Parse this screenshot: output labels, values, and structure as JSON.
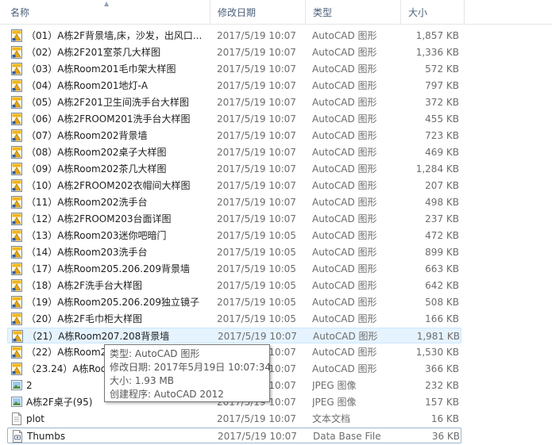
{
  "columns": {
    "name": "名称",
    "date": "修改日期",
    "type": "类型",
    "size": "大小"
  },
  "files": [
    {
      "name": "（01）A栋2F背景墙,床，沙发，出风口...",
      "date": "2017/5/19 10:07",
      "type": "AutoCAD 图形",
      "size": "1,857 KB",
      "icon": "autocad-icon"
    },
    {
      "name": "（02）A栋2F201室茶几大样图",
      "date": "2017/5/19 10:07",
      "type": "AutoCAD 图形",
      "size": "1,336 KB",
      "icon": "autocad-icon"
    },
    {
      "name": "（03）A栋Room201毛巾架大样图",
      "date": "2017/5/19 10:07",
      "type": "AutoCAD 图形",
      "size": "572 KB",
      "icon": "autocad-icon"
    },
    {
      "name": "（04）A栋Room201地灯-A",
      "date": "2017/5/19 10:07",
      "type": "AutoCAD 图形",
      "size": "797 KB",
      "icon": "autocad-icon"
    },
    {
      "name": "（05）A栋2F201卫生间洗手台大样图",
      "date": "2017/5/19 10:07",
      "type": "AutoCAD 图形",
      "size": "372 KB",
      "icon": "autocad-icon"
    },
    {
      "name": "（06）A栋2FROOM201洗手台大样图",
      "date": "2017/5/19 10:07",
      "type": "AutoCAD 图形",
      "size": "455 KB",
      "icon": "autocad-icon"
    },
    {
      "name": "（07）A栋Room202背景墙",
      "date": "2017/5/19 10:07",
      "type": "AutoCAD 图形",
      "size": "723 KB",
      "icon": "autocad-icon"
    },
    {
      "name": "（08）A栋Room202桌子大样图",
      "date": "2017/5/19 10:07",
      "type": "AutoCAD 图形",
      "size": "469 KB",
      "icon": "autocad-icon"
    },
    {
      "name": "（09）A栋Room202茶几大样图",
      "date": "2017/5/19 10:07",
      "type": "AutoCAD 图形",
      "size": "1,284 KB",
      "icon": "autocad-icon"
    },
    {
      "name": "（10）A栋2FROOM202衣帽间大样图",
      "date": "2017/5/19 10:07",
      "type": "AutoCAD 图形",
      "size": "207 KB",
      "icon": "autocad-icon"
    },
    {
      "name": "（11）A栋Room202洗手台",
      "date": "2017/5/19 10:07",
      "type": "AutoCAD 图形",
      "size": "498 KB",
      "icon": "autocad-icon"
    },
    {
      "name": "（12）A栋2FROOM203台面详图",
      "date": "2017/5/19 10:07",
      "type": "AutoCAD 图形",
      "size": "237 KB",
      "icon": "autocad-icon"
    },
    {
      "name": "（13）A栋Room203迷你吧暗门",
      "date": "2017/5/19 10:05",
      "type": "AutoCAD 图形",
      "size": "472 KB",
      "icon": "autocad-icon"
    },
    {
      "name": "（14）A栋Room203洗手台",
      "date": "2017/5/19 10:05",
      "type": "AutoCAD 图形",
      "size": "899 KB",
      "icon": "autocad-icon"
    },
    {
      "name": "（17）A栋Room205.206.209背景墙",
      "date": "2017/5/19 10:05",
      "type": "AutoCAD 图形",
      "size": "663 KB",
      "icon": "autocad-icon"
    },
    {
      "name": "（18）A栋2F洗手台大样图",
      "date": "2017/5/19 10:05",
      "type": "AutoCAD 图形",
      "size": "642 KB",
      "icon": "autocad-icon"
    },
    {
      "name": "（19）A栋Room205.206.209独立镜子",
      "date": "2017/5/19 10:05",
      "type": "AutoCAD 图形",
      "size": "508 KB",
      "icon": "autocad-icon"
    },
    {
      "name": "（20）A栋2F毛巾柜大样图",
      "date": "2017/5/19 10:05",
      "type": "AutoCAD 图形",
      "size": "166 KB",
      "icon": "autocad-icon"
    },
    {
      "name": "（21）A栋Room207.208背景墙",
      "date": "2017/5/19 10:07",
      "type": "AutoCAD 图形",
      "size": "1,981 KB",
      "icon": "autocad-icon",
      "state": "hover"
    },
    {
      "name": "（22）A栋Room2",
      "date": "2017/5/19 10:07",
      "type": "AutoCAD 图形",
      "size": "1,530 KB",
      "icon": "autocad-icon"
    },
    {
      "name": "（23.24）A栋Roo",
      "date": "2017/5/19 10:07",
      "type": "AutoCAD 图形",
      "size": "366 KB",
      "icon": "autocad-icon"
    },
    {
      "name": "2",
      "date": "2017/5/19 10:07",
      "type": "JPEG 图像",
      "size": "232 KB",
      "icon": "image-icon"
    },
    {
      "name": "A栋2F桌子(95)",
      "date": "2017/5/19 10:07",
      "type": "JPEG 图像",
      "size": "157 KB",
      "icon": "image-icon"
    },
    {
      "name": "plot",
      "date": "2017/5/19 10:07",
      "type": "文本文档",
      "size": "16 KB",
      "icon": "text-file-icon"
    },
    {
      "name": "Thumbs",
      "date": "2017/5/19 10:07",
      "type": "Data Base File",
      "size": "36 KB",
      "icon": "database-file-icon",
      "state": "focus"
    }
  ],
  "tooltip": {
    "type_line": "类型: AutoCAD 图形",
    "date_line": "修改日期: 2017年5月19日 10:07:34",
    "size_line": "大小: 1.93 MB",
    "creator_line": "创建程序: AutoCAD 2012"
  }
}
